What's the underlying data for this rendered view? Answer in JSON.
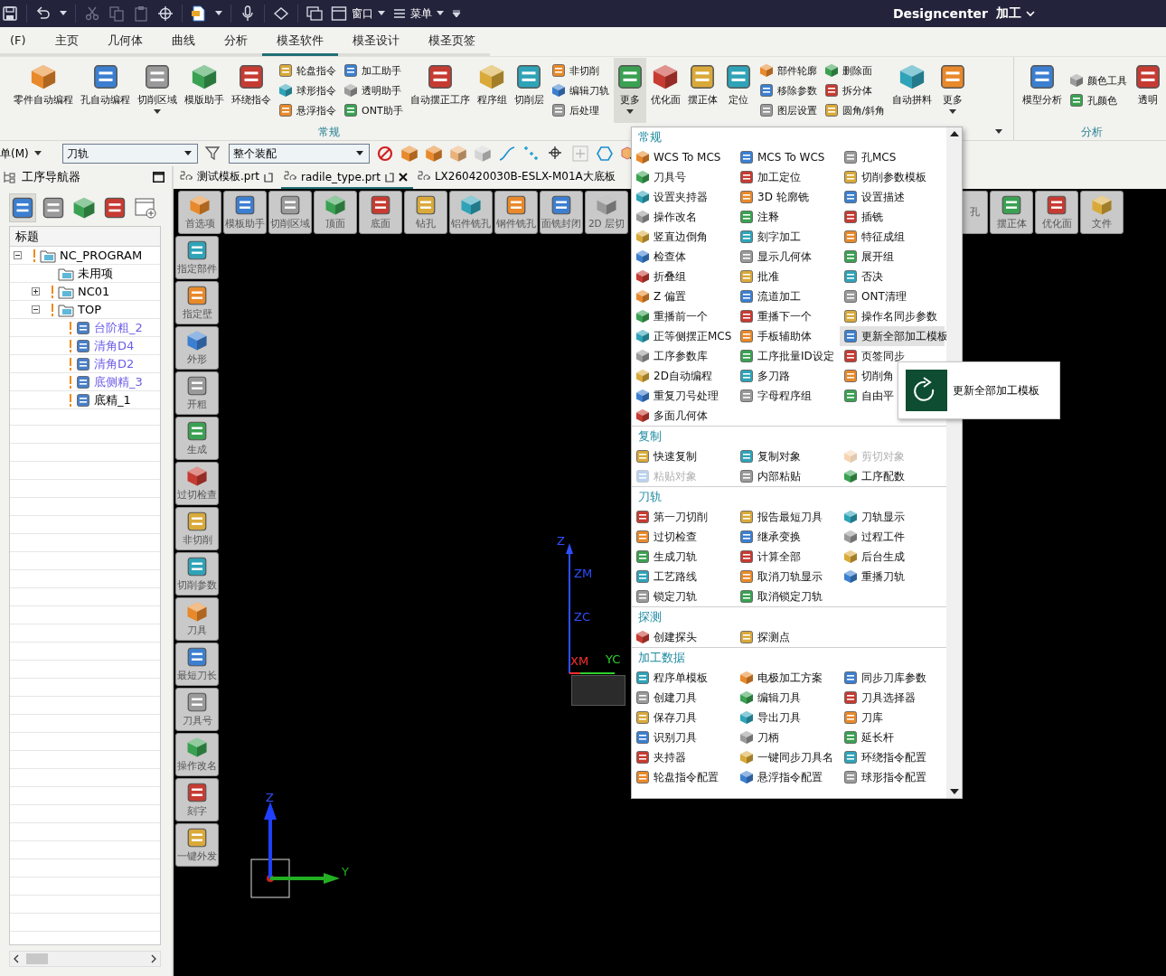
{
  "title_bar": {
    "window_menu": "窗口",
    "menu": "菜单",
    "app": "Designcenter",
    "mode": "加工"
  },
  "ribbon_tabs": [
    {
      "label": "(F)",
      "selected": false
    },
    {
      "label": "主页",
      "selected": false
    },
    {
      "label": "几何体",
      "selected": false
    },
    {
      "label": "曲线",
      "selected": false
    },
    {
      "label": "分析",
      "selected": false
    },
    {
      "label": "模圣软件",
      "selected": true
    },
    {
      "label": "模圣设计",
      "selected": false
    },
    {
      "label": "模圣页签",
      "selected": false
    }
  ],
  "ribbon": {
    "groups": [
      {
        "label": "常规",
        "items": [
          {
            "kind": "large",
            "label": "零件自动编程",
            "dropdown": false,
            "active": false
          },
          {
            "kind": "large",
            "label": "孔自动编程",
            "dropdown": false,
            "active": false
          },
          {
            "kind": "large",
            "label": "切削区域",
            "dropdown": true,
            "active": false
          },
          {
            "kind": "large",
            "label": "模版助手",
            "dropdown": false,
            "active": false
          },
          {
            "kind": "large",
            "label": "环绕指令",
            "dropdown": false,
            "active": false
          },
          {
            "kind": "stack",
            "items": [
              "轮盘指令",
              "球形指令",
              "悬浮指令"
            ]
          },
          {
            "kind": "stack",
            "items": [
              "加工助手",
              "透明助手",
              "ONT助手"
            ]
          },
          {
            "kind": "large",
            "label": "自动摆正工序",
            "dropdown": false,
            "active": false
          },
          {
            "kind": "large",
            "label": "程序组",
            "dropdown": false,
            "active": false
          },
          {
            "kind": "large",
            "label": "切削层",
            "dropdown": false,
            "active": false
          },
          {
            "kind": "stack",
            "items": [
              "非切削",
              "编辑刀轨",
              "后处理"
            ]
          },
          {
            "kind": "large",
            "label": "更多",
            "dropdown": true,
            "active": true
          },
          {
            "kind": "large",
            "label": "优化面",
            "dropdown": false,
            "active": false
          },
          {
            "kind": "large",
            "label": "摆正体",
            "dropdown": false,
            "active": false
          },
          {
            "kind": "large",
            "label": "定位",
            "dropdown": false,
            "active": false
          },
          {
            "kind": "stack",
            "items": [
              "部件轮廓",
              "移除参数",
              "图层设置"
            ]
          },
          {
            "kind": "stack",
            "items": [
              "删除面",
              "拆分体",
              "圆角/斜角"
            ]
          },
          {
            "kind": "large",
            "label": "自动拼料",
            "dropdown": false,
            "active": false
          },
          {
            "kind": "large",
            "label": "更多",
            "dropdown": true,
            "active": false
          }
        ]
      },
      {
        "label": "分析",
        "items": [
          {
            "kind": "large",
            "label": "模型分析",
            "dropdown": false,
            "active": false
          },
          {
            "kind": "stack",
            "items": [
              "颜色工具",
              "孔颜色"
            ]
          },
          {
            "kind": "large",
            "label": "透明",
            "dropdown": false,
            "active": false
          }
        ]
      }
    ]
  },
  "selection_bar": {
    "menu": "单(M)",
    "filter": "刀轨",
    "scope": "整个装配"
  },
  "navigator": {
    "title": "工序导航器",
    "column": "标题",
    "tree": [
      {
        "label": "NC_PROGRAM",
        "kind": "folder",
        "flag": true,
        "expanded": true,
        "children": [
          {
            "label": "未用项",
            "kind": "folder",
            "flag": false
          },
          {
            "label": "NC01",
            "kind": "folder",
            "flag": true,
            "expanded": false
          },
          {
            "label": "TOP",
            "kind": "folder",
            "flag": true,
            "expanded": true,
            "children": [
              {
                "label": "台阶粗_2",
                "kind": "operation",
                "flag": true,
                "color": "#6a5ce6"
              },
              {
                "label": "清角D4",
                "kind": "operation",
                "flag": true,
                "color": "#6a5ce6"
              },
              {
                "label": "清角D2",
                "kind": "operation",
                "flag": true,
                "color": "#6a5ce6"
              },
              {
                "label": "底侧精_3",
                "kind": "operation",
                "flag": true,
                "color": "#6a5ce6"
              },
              {
                "label": "底精_1",
                "kind": "operation",
                "flag": true,
                "color": "#000000"
              }
            ]
          }
        ]
      }
    ]
  },
  "file_tabs": [
    {
      "label": "测试模板.prt",
      "selected": false,
      "closable": false
    },
    {
      "label": "radile_type.prt",
      "selected": true,
      "closable": true
    },
    {
      "label": "LX260420030B-ESLX-M01A大底板",
      "selected": false,
      "closable": false
    }
  ],
  "viewport": {
    "top_toolbar": [
      "首选项",
      "模板助手",
      "切削区域",
      "顶面",
      "底面",
      "钻孔",
      "铝件铣孔",
      "钢件铣孔",
      "面铣封闭",
      "2D 层切"
    ],
    "right_toolbar": [
      "孔",
      "摆正体",
      "优化面",
      "文件"
    ],
    "side_toolbar": [
      "指定部件",
      "指定壁",
      "外形",
      "开粗",
      "生成",
      "过切检查",
      "非切削",
      "切削参数",
      "刀具",
      "最短刀长",
      "刀具号",
      "操作改名",
      "刻字",
      "一键外发"
    ],
    "axes": {
      "work": [
        "Z",
        "ZM",
        "ZC",
        "XM",
        "YC"
      ],
      "view": [
        "Z",
        "Y"
      ]
    }
  },
  "menu": {
    "sections": [
      {
        "title": "常规",
        "items": [
          {
            "label": "WCS To MCS",
            "disabled": false,
            "highlighted": false
          },
          {
            "label": "MCS To WCS",
            "disabled": false,
            "highlighted": false
          },
          {
            "label": "孔MCS",
            "disabled": false,
            "highlighted": false
          },
          {
            "label": "刀具号",
            "disabled": false,
            "highlighted": false
          },
          {
            "label": "加工定位",
            "disabled": false,
            "highlighted": false
          },
          {
            "label": "切削参数模板",
            "disabled": false,
            "highlighted": false
          },
          {
            "label": "设置夹持器",
            "disabled": false,
            "highlighted": false
          },
          {
            "label": "3D 轮廓铣",
            "disabled": false,
            "highlighted": false
          },
          {
            "label": "设置描述",
            "disabled": false,
            "highlighted": false
          },
          {
            "label": "操作改名",
            "disabled": false,
            "highlighted": false
          },
          {
            "label": "注释",
            "disabled": false,
            "highlighted": false
          },
          {
            "label": "插铣",
            "disabled": false,
            "highlighted": false
          },
          {
            "label": "竖直边倒角",
            "disabled": false,
            "highlighted": false
          },
          {
            "label": "刻字加工",
            "disabled": false,
            "highlighted": false
          },
          {
            "label": "特征成组",
            "disabled": false,
            "highlighted": false
          },
          {
            "label": "检查体",
            "disabled": false,
            "highlighted": false
          },
          {
            "label": "显示几何体",
            "disabled": false,
            "highlighted": false
          },
          {
            "label": "展开组",
            "disabled": false,
            "highlighted": false
          },
          {
            "label": "折叠组",
            "disabled": false,
            "highlighted": false
          },
          {
            "label": "批准",
            "disabled": false,
            "highlighted": false
          },
          {
            "label": "否决",
            "disabled": false,
            "highlighted": false
          },
          {
            "label": "Z 偏置",
            "disabled": false,
            "highlighted": false
          },
          {
            "label": "流道加工",
            "disabled": false,
            "highlighted": false
          },
          {
            "label": "ONT清理",
            "disabled": false,
            "highlighted": false
          },
          {
            "label": "重播前一个",
            "disabled": false,
            "highlighted": false
          },
          {
            "label": "重播下一个",
            "disabled": false,
            "highlighted": false
          },
          {
            "label": "操作名同步参数",
            "disabled": false,
            "highlighted": false
          },
          {
            "label": "正等侧摆正MCS",
            "disabled": false,
            "highlighted": false
          },
          {
            "label": "手板辅助体",
            "disabled": false,
            "highlighted": false
          },
          {
            "label": "更新全部加工模板",
            "disabled": false,
            "highlighted": true
          },
          {
            "label": "工序参数库",
            "disabled": false,
            "highlighted": false
          },
          {
            "label": "工序批量ID设定",
            "disabled": false,
            "highlighted": false
          },
          {
            "label": "页签同步",
            "disabled": false,
            "highlighted": false
          },
          {
            "label": "2D自动编程",
            "disabled": false,
            "highlighted": false
          },
          {
            "label": "多刀路",
            "disabled": false,
            "highlighted": false
          },
          {
            "label": "切削角",
            "disabled": false,
            "highlighted": false
          },
          {
            "label": "重复刀号处理",
            "disabled": false,
            "highlighted": false
          },
          {
            "label": "字母程序组",
            "disabled": false,
            "highlighted": false
          },
          {
            "label": "自由平",
            "disabled": false,
            "highlighted": false
          },
          {
            "label": "多面几何体",
            "disabled": false,
            "highlighted": false
          }
        ]
      },
      {
        "title": "复制",
        "items": [
          {
            "label": "快速复制",
            "disabled": false,
            "highlighted": false
          },
          {
            "label": "复制对象",
            "disabled": false,
            "highlighted": false
          },
          {
            "label": "剪切对象",
            "disabled": true,
            "highlighted": false
          },
          {
            "label": "粘贴对象",
            "disabled": true,
            "highlighted": false
          },
          {
            "label": "内部粘贴",
            "disabled": false,
            "highlighted": false
          },
          {
            "label": "工序配数",
            "disabled": false,
            "highlighted": false
          }
        ]
      },
      {
        "title": "刀轨",
        "items": [
          {
            "label": "第一刀切削",
            "disabled": false,
            "highlighted": false
          },
          {
            "label": "报告最短刀具",
            "disabled": false,
            "highlighted": false
          },
          {
            "label": "刀轨显示",
            "disabled": false,
            "highlighted": false
          },
          {
            "label": "过切检查",
            "disabled": false,
            "highlighted": false
          },
          {
            "label": "继承变换",
            "disabled": false,
            "highlighted": false
          },
          {
            "label": "过程工件",
            "disabled": false,
            "highlighted": false
          },
          {
            "label": "生成刀轨",
            "disabled": false,
            "highlighted": false
          },
          {
            "label": "计算全部",
            "disabled": false,
            "highlighted": false
          },
          {
            "label": "后台生成",
            "disabled": false,
            "highlighted": false
          },
          {
            "label": "工艺路线",
            "disabled": false,
            "highlighted": false
          },
          {
            "label": "取消刀轨显示",
            "disabled": false,
            "highlighted": false
          },
          {
            "label": "重播刀轨",
            "disabled": false,
            "highlighted": false
          },
          {
            "label": "锁定刀轨",
            "disabled": false,
            "highlighted": false
          },
          {
            "label": "取消锁定刀轨",
            "disabled": false,
            "highlighted": false
          }
        ]
      },
      {
        "title": "探测",
        "items": [
          {
            "label": "创建探头",
            "disabled": false,
            "highlighted": false
          },
          {
            "label": "探测点",
            "disabled": false,
            "highlighted": false
          }
        ]
      },
      {
        "title": "加工数据",
        "items": [
          {
            "label": "程序单模板",
            "disabled": false,
            "highlighted": false
          },
          {
            "label": "电极加工方案",
            "disabled": false,
            "highlighted": false
          },
          {
            "label": "同步刀库参数",
            "disabled": false,
            "highlighted": false
          },
          {
            "label": "创建刀具",
            "disabled": false,
            "highlighted": false
          },
          {
            "label": "编辑刀具",
            "disabled": false,
            "highlighted": false
          },
          {
            "label": "刀具选择器",
            "disabled": false,
            "highlighted": false
          },
          {
            "label": "保存刀具",
            "disabled": false,
            "highlighted": false
          },
          {
            "label": "导出刀具",
            "disabled": false,
            "highlighted": false
          },
          {
            "label": "刀库",
            "disabled": false,
            "highlighted": false
          },
          {
            "label": "识别刀具",
            "disabled": false,
            "highlighted": false
          },
          {
            "label": "刀柄",
            "disabled": false,
            "highlighted": false
          },
          {
            "label": "延长杆",
            "disabled": false,
            "highlighted": false
          },
          {
            "label": "夹持器",
            "disabled": false,
            "highlighted": false
          },
          {
            "label": "一键同步刀具名",
            "disabled": false,
            "highlighted": false
          },
          {
            "label": "环绕指令配置",
            "disabled": false,
            "highlighted": false
          },
          {
            "label": "轮盘指令配置",
            "disabled": false,
            "highlighted": false
          },
          {
            "label": "悬浮指令配置",
            "disabled": false,
            "highlighted": false
          },
          {
            "label": "球形指令配置",
            "disabled": false,
            "highlighted": false
          }
        ]
      }
    ]
  },
  "tooltip": {
    "text": "更新全部加工模板"
  }
}
